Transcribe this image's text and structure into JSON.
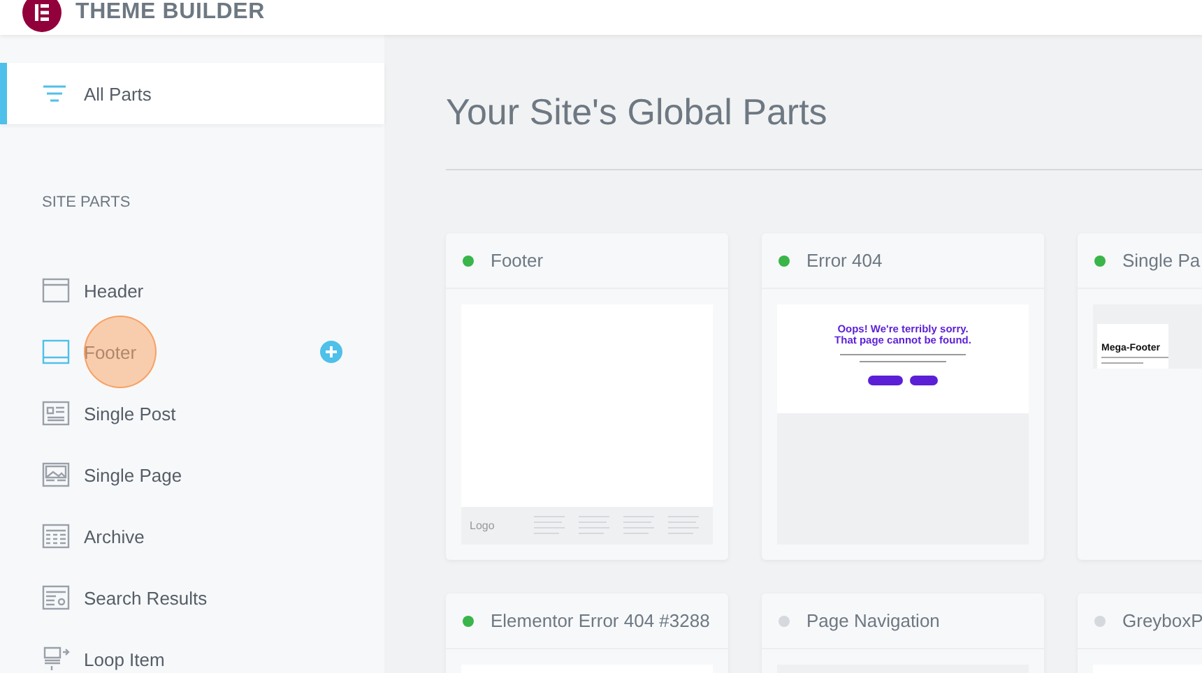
{
  "app_title": "THEME BUILDER",
  "sidebar": {
    "top_item": {
      "label": "All Parts",
      "selected": true
    },
    "section_title": "SITE PARTS",
    "items": [
      {
        "label": "Header",
        "kind": "header",
        "selected": false
      },
      {
        "label": "Footer",
        "kind": "footer",
        "selected": true
      },
      {
        "label": "Single Post",
        "kind": "post",
        "selected": false
      },
      {
        "label": "Single Page",
        "kind": "page",
        "selected": false
      },
      {
        "label": "Archive",
        "kind": "archive",
        "selected": false
      },
      {
        "label": "Search Results",
        "kind": "search",
        "selected": false
      },
      {
        "label": "Loop Item",
        "kind": "loop",
        "selected": false
      }
    ]
  },
  "page_title": "Your Site's Global Parts",
  "cards": [
    {
      "title": "Footer",
      "active": true,
      "preview": {
        "kind": "footer",
        "text": "Logo"
      }
    },
    {
      "title": "Error 404",
      "active": true,
      "preview": {
        "kind": "error",
        "text": "Oops! We're terribly sorry. That page cannot be found."
      }
    },
    {
      "title": "Single Pa",
      "active": true,
      "preview": {
        "kind": "mega",
        "text": "Mega-Footer"
      }
    },
    {
      "title": "Elementor Error 404 #3288",
      "active": true,
      "preview": {
        "kind": "white"
      }
    },
    {
      "title": "Page Navigation",
      "active": false,
      "preview": {
        "kind": "grey"
      }
    },
    {
      "title": "GreyboxP",
      "active": false,
      "preview": {
        "kind": "white"
      }
    }
  ]
}
